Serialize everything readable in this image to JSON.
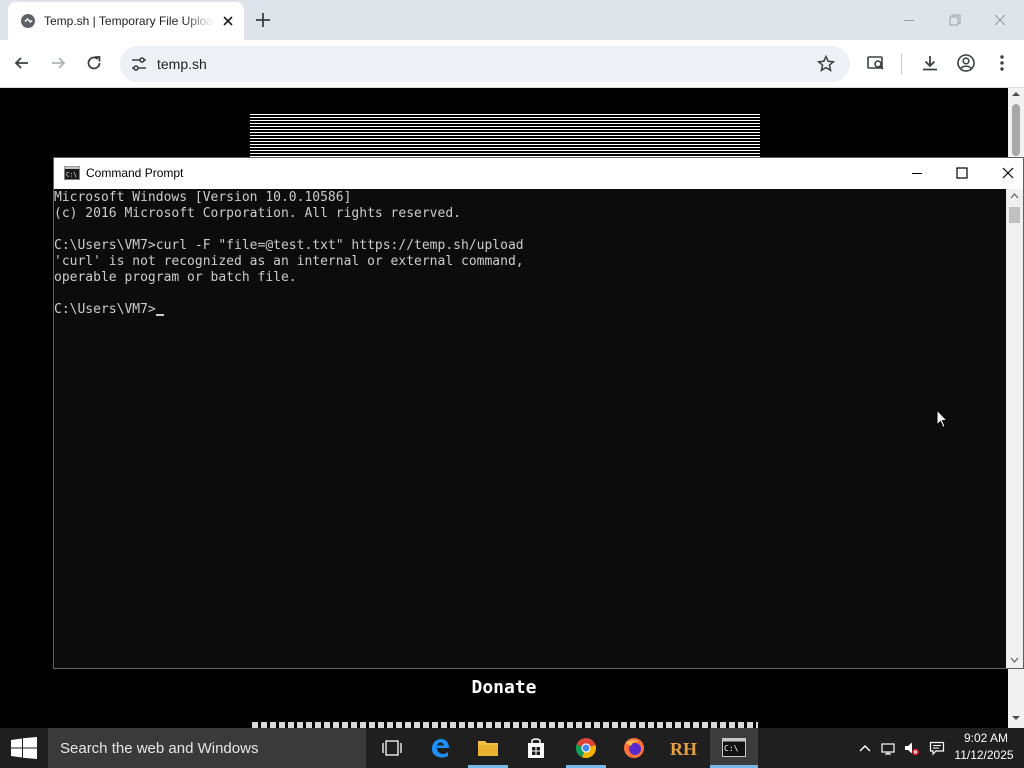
{
  "browser": {
    "tab": {
      "title": "Temp.sh | Temporary File Upload"
    },
    "omnibox": {
      "url": "temp.sh"
    }
  },
  "webpage": {
    "donate_heading": "Donate"
  },
  "cmd": {
    "title": "Command Prompt",
    "lines": [
      "Microsoft Windows [Version 10.0.10586]",
      "(c) 2016 Microsoft Corporation. All rights reserved.",
      "",
      "C:\\Users\\VM7>curl -F \"file=@test.txt\" https://temp.sh/upload",
      "'curl' is not recognized as an internal or external command,",
      "operable program or batch file.",
      "",
      "C:\\Users\\VM7>"
    ]
  },
  "taskbar": {
    "search_placeholder": "Search the web and Windows",
    "clock_time": "9:02 AM",
    "clock_date": "11/12/2025",
    "apps": [
      "task-view",
      "edge",
      "file-explorer",
      "store",
      "chrome",
      "firefox",
      "rh",
      "command-prompt"
    ]
  },
  "colors": {
    "taskbar_bg": "#1f1f1f",
    "console_bg": "#0c0c0c",
    "console_text": "#cccccc",
    "active_app_accent": "#76b9ed"
  }
}
